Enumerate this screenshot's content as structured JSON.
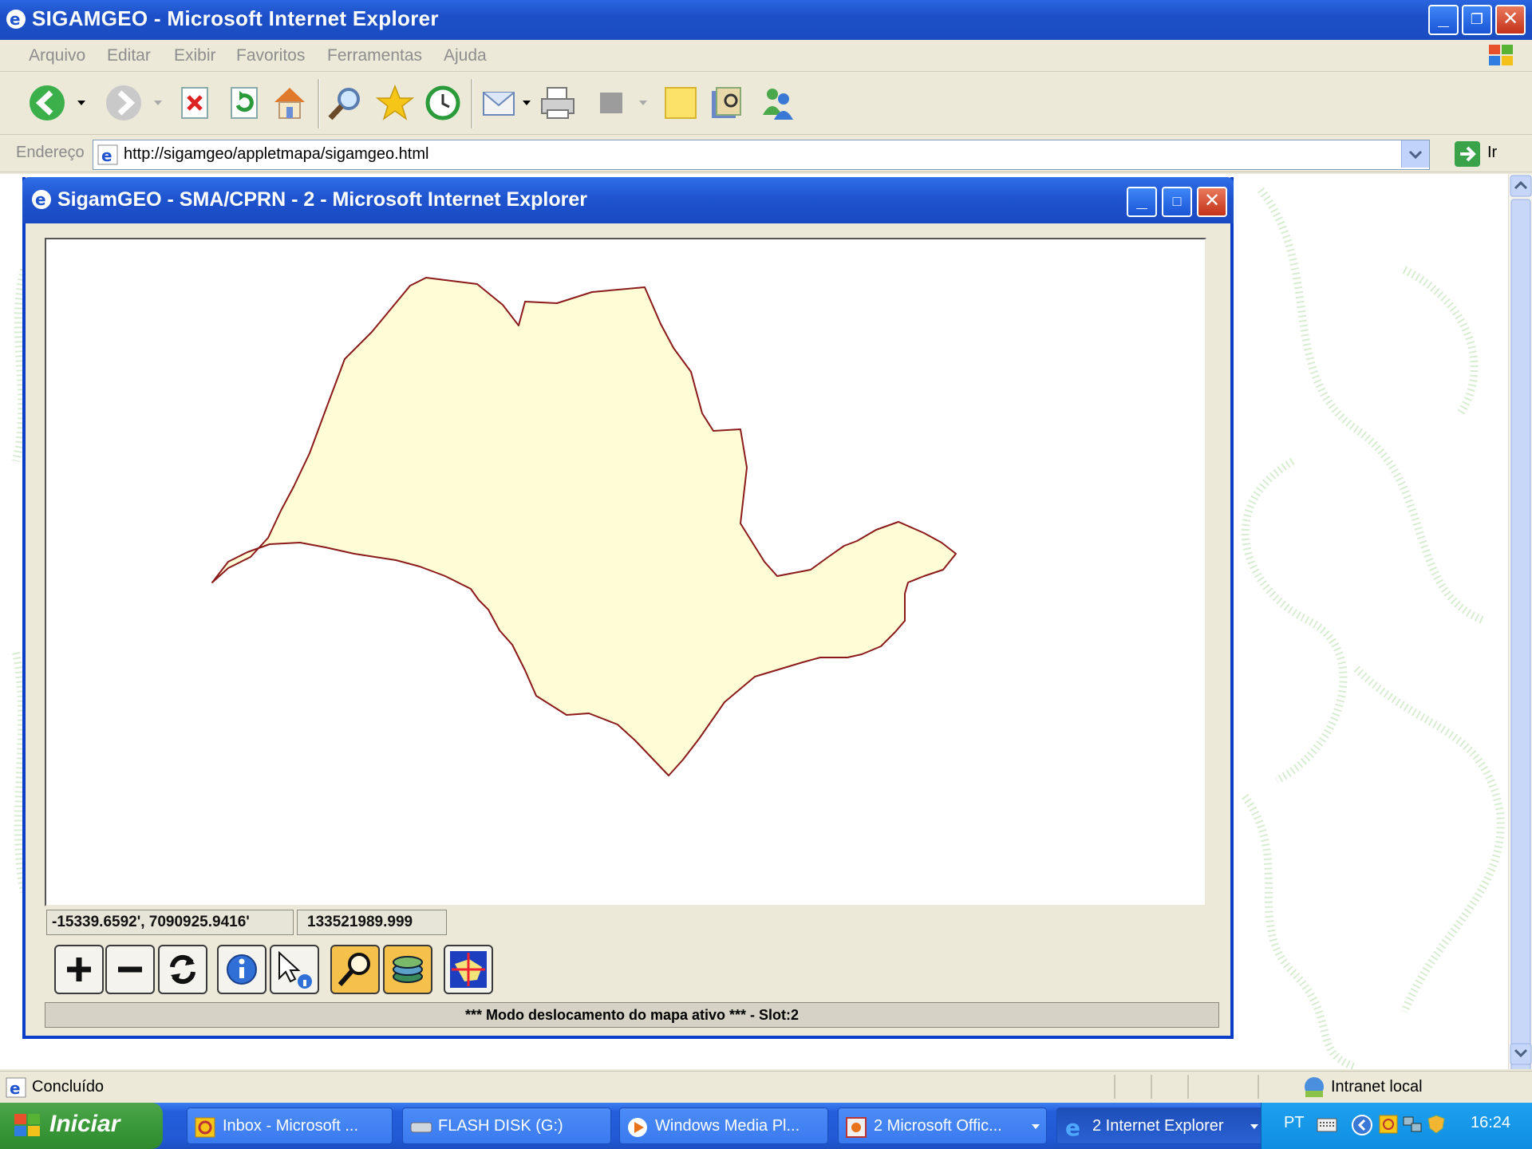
{
  "window": {
    "title": "SIGAMGEO - Microsoft Internet Explorer"
  },
  "menu": [
    "Arquivo",
    "Editar",
    "Exibir",
    "Favoritos",
    "Ferramentas",
    "Ajuda"
  ],
  "toolbar_icons": [
    "back-icon",
    "dropdown-icon",
    "forward-icon",
    "dropdown-icon",
    "stop-icon",
    "refresh-icon",
    "home-icon",
    "search-icon",
    "favorites-icon",
    "history-icon",
    "mail-icon",
    "print-icon",
    "edit-icon",
    "note-icon",
    "research-icon",
    "messenger-icon"
  ],
  "address": {
    "label": "Endereço",
    "url": "http://sigamgeo/appletmapa/sigamgeo.html",
    "go_label": "Ir"
  },
  "popup": {
    "title": "SigamGEO - SMA/CPRN - 2 - Microsoft Internet Explorer",
    "coords": "-15339.6592', 7090925.9416'",
    "scale": "133521989.999",
    "tools": [
      "zoom-in-tool",
      "zoom-out-tool",
      "refresh-tool",
      "info-tool",
      "select-info-tool",
      "pan-tool",
      "layers-tool",
      "full-extent-tool"
    ],
    "mode_text": "*** Modo deslocamento do mapa ativo *** - Slot:2"
  },
  "status": {
    "text": "Concluído",
    "zone": "Intranet local"
  },
  "taskbar": {
    "start_label": "Iniciar",
    "tasks": [
      "Inbox - Microsoft ...",
      "FLASH DISK (G:)",
      "Windows Media Pl...",
      "2 Microsoft Offic...",
      "2 Internet Explorer"
    ],
    "lang": "PT",
    "clock": "16:24"
  },
  "colors": {
    "map_fill": "#fffdd6",
    "map_border": "#8b1a1a",
    "title_blue": "#1f54cf"
  }
}
